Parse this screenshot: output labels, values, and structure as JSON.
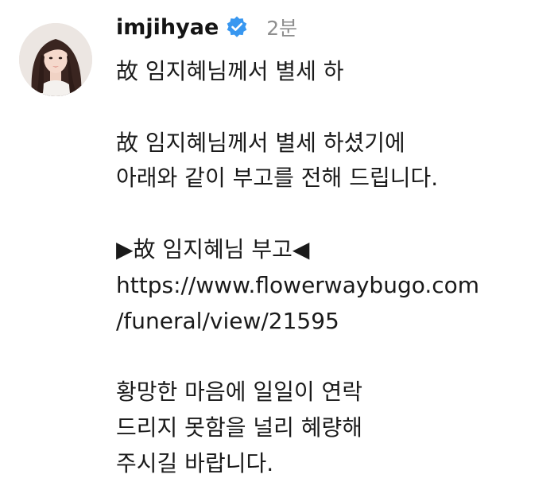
{
  "post": {
    "username": "imjihyae",
    "verified_icon": "verified-badge-icon",
    "time_ago": "2분",
    "caption_lines": [
      "故 임지혜님께서 별세 하",
      "",
      "故 임지혜님께서 별세 하셨기에",
      "아래와 같이 부고를 전해 드립니다.",
      "",
      "▶故 임지혜님 부고◀",
      "https://www.flowerwaybugo.com",
      "/funeral/view/21595",
      "",
      "황망한 마음에 일일이 연락",
      "드리지 못함을 널리 혜량해",
      "주시길 바랍니다."
    ]
  },
  "colors": {
    "text": "#1a1a1a",
    "time": "#8e8e8e",
    "verified": "#3897f0",
    "background": "#ffffff"
  }
}
